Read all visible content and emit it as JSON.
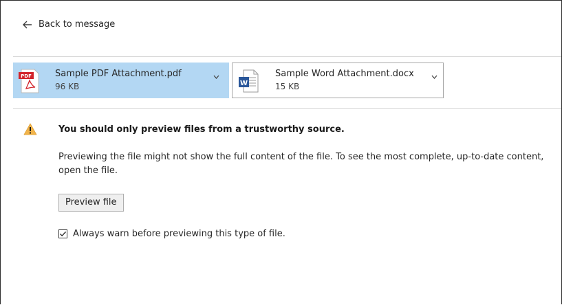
{
  "nav": {
    "back_label": "Back to message"
  },
  "attachments": [
    {
      "name": "Sample PDF Attachment.pdf",
      "size": "96 KB",
      "icon": "pdf-file-icon",
      "icon_badge": "PDF",
      "selected": true
    },
    {
      "name": "Sample Word Attachment.docx",
      "size": "15 KB",
      "icon": "word-file-icon",
      "icon_badge": "W",
      "selected": false
    }
  ],
  "warning": {
    "icon": "warning-icon",
    "title": "You should only preview files from a trustworthy source.",
    "body": "Previewing the file might not show the full content of the file. To see the most complete, up-to-date content, open the file.",
    "preview_button": "Preview file",
    "checkbox_label": "Always warn before previewing this type of file.",
    "checkbox_checked": true
  },
  "colors": {
    "selected_attachment_bg": "#b3d7f3",
    "pdf_red": "#d2232a",
    "word_blue": "#2b579a",
    "warning_yellow": "#f2b44a"
  }
}
